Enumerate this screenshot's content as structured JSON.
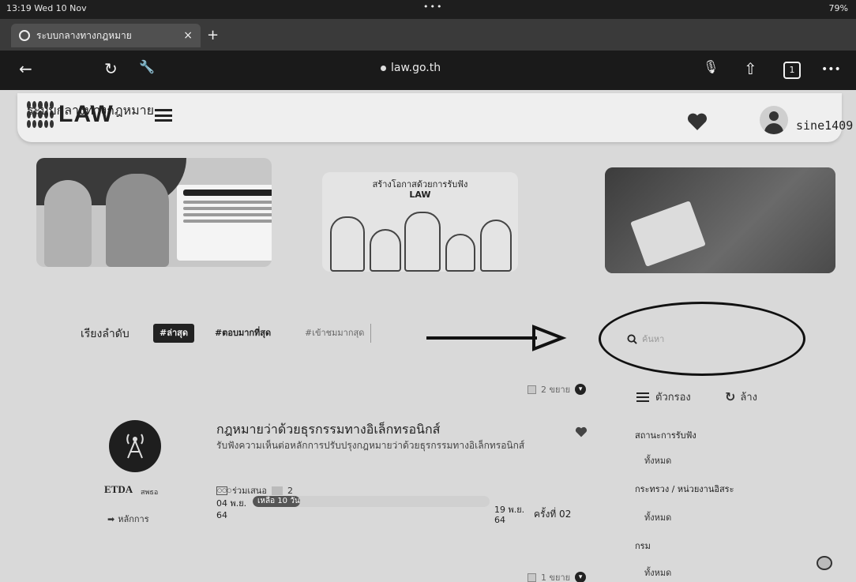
{
  "status_bar": {
    "time": "13:19  Wed 10 Nov",
    "dots": "•••",
    "battery": "79%"
  },
  "browser": {
    "tab_title": "ระบบกลางทางกฎหมาย",
    "tab_close": "×",
    "new_tab": "+",
    "back": "←",
    "reload": "↻",
    "tools": "🔧",
    "url": "law.go.th",
    "mic": "🎙",
    "share": "⇧",
    "tab_count": "1",
    "more": "•••"
  },
  "site": {
    "logo_text": "LAW",
    "logo_sub": "ระบบกลางทางกฎหมาย",
    "username": "sine1409"
  },
  "banners": {
    "b2_title": "สร้างโอกาสด้วยการรับฟัง",
    "b2_logo": "LAW"
  },
  "sort": {
    "label": "เรียงลำดับ",
    "options": [
      "#ล่าสุด",
      "#ตอบมากที่สุด",
      "#เข้าชมมากสุด"
    ]
  },
  "search": {
    "placeholder": "ค้นหา"
  },
  "expand_counts": {
    "first": "2 ขยาย",
    "second": "1 ขยาย"
  },
  "filter": {
    "filter_label": "ตัวกรอง",
    "clear_label": "ล้าง",
    "sections": [
      {
        "label": "สถานะการรับฟัง",
        "value": "ทั้งหมด"
      },
      {
        "label": "กระทรวง / หน่วยงานอิสระ",
        "value": "ทั้งหมด"
      },
      {
        "label": "กรม",
        "value": "ทั้งหมด"
      }
    ]
  },
  "item": {
    "title": "กฎหมายว่าด้วยธุรกรรมทางอิเล็กทรอนิกส์",
    "description": "รับฟังความเห็นต่อหลักการปรับปรุงกฎหมายว่าด้วยธุรกรรมทางอิเล็กทรอนิกส์",
    "org": "ETDA",
    "org_sub": "สพธอ",
    "principle": "หลักการ",
    "participants": "ร่วมเสนอ",
    "comments": "2",
    "start_date": "04 พ.ย.",
    "start_year": "64",
    "remaining": "เหลือ 10 วัน",
    "remaining_progress": 0.2,
    "end_date": "19 พ.ย.",
    "end_year": "64",
    "round": "ครั้งที่  02"
  },
  "colors": {
    "dark": "#1a1a1a",
    "chip_active": "#222222",
    "panel": "#efefef"
  }
}
